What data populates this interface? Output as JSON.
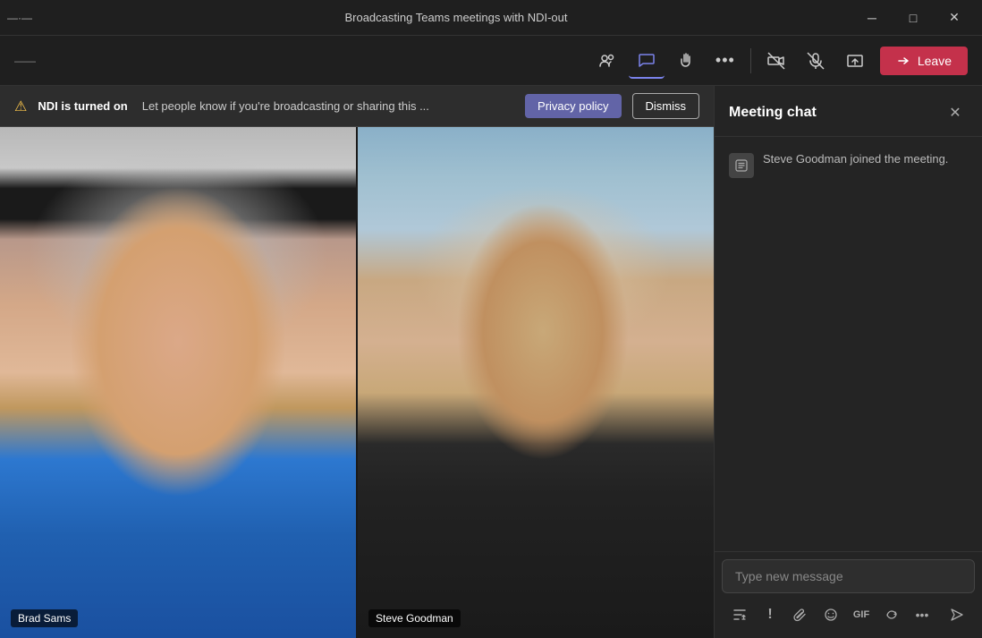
{
  "titleBar": {
    "title": "Broadcasting Teams meetings with NDI-out",
    "leftLabel": "—·—",
    "minimize": "─",
    "maximize": "□",
    "close": "✕"
  },
  "toolbar": {
    "leftLabel": "——",
    "participantsIcon": "👥",
    "chatIcon": "💬",
    "raiseHandIcon": "✋",
    "moreIcon": "•••",
    "cameraIcon": "📷",
    "micIcon": "🎙",
    "shareIcon": "↑",
    "leaveLabel": "Leave"
  },
  "ndiBanner": {
    "warningIcon": "⚠",
    "boldText": "NDI is turned on",
    "description": "Let people know if you're broadcasting or sharing this ...",
    "privacyPolicyLabel": "Privacy policy",
    "dismissLabel": "Dismiss"
  },
  "videoArea": {
    "participants": [
      {
        "name": "Brad Sams"
      },
      {
        "name": "Steve Goodman"
      }
    ]
  },
  "chat": {
    "title": "Meeting chat",
    "closeIcon": "✕",
    "systemMessage": {
      "icon": "👤",
      "text": "Steve Goodman joined the meeting."
    },
    "inputPlaceholder": "Type new message",
    "toolbar": {
      "formatIcon": "A",
      "urgentIcon": "!",
      "attachIcon": "📎",
      "emojiIcon": "🙂",
      "gifIcon": "GIF",
      "loopIcon": "↻",
      "moreIcon": "•••",
      "sendIcon": "➤"
    }
  }
}
